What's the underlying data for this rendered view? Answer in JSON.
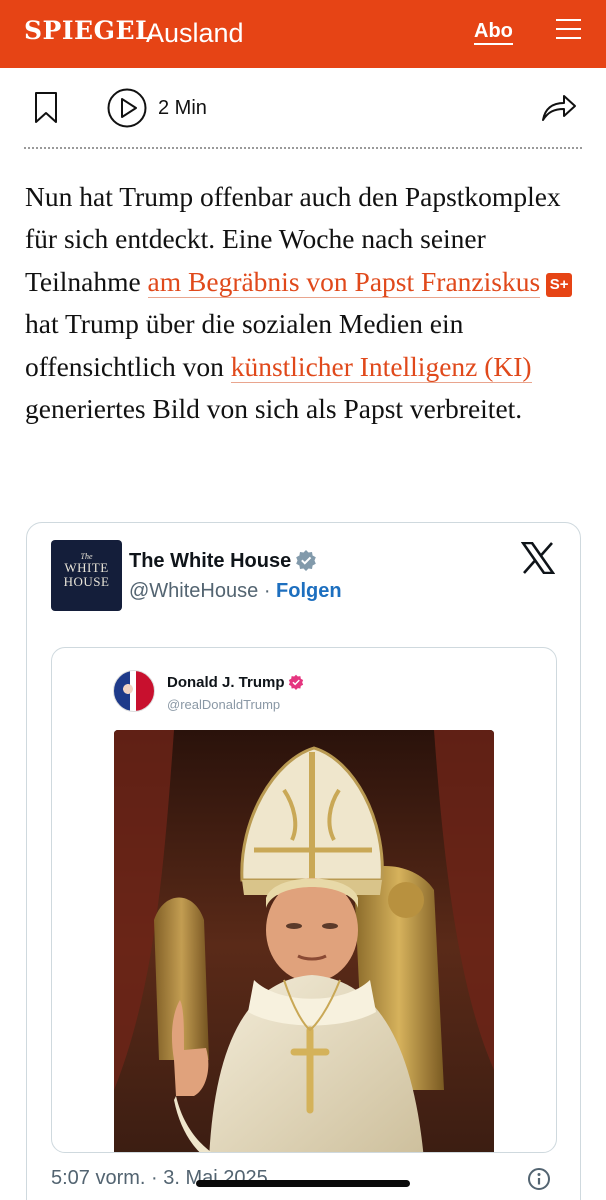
{
  "header": {
    "logo": "SPIEGEL",
    "section": "Ausland",
    "abo_label": "Abo",
    "menu_icon": "hamburger-icon",
    "background_color": "#e64415"
  },
  "actions": {
    "bookmark_icon": "bookmark-icon",
    "audio_icon": "play-icon",
    "read_time": "2 Min",
    "share_icon": "share-icon"
  },
  "article": {
    "text_1": "Nun hat Trump offenbar auch den Papstkomplex für sich entdeckt. Eine Woche nach seiner Teilnahme ",
    "link_1": "am Begräbnis von Papst Franziskus",
    "badge": "S+",
    "text_2": " hat Trump über die sozialen Medien ein offensichtlich von ",
    "link_2": "künstlicher Intelligenz (KI)",
    "text_3": " generiertes Bild von sich als Papst verbreitet.",
    "link_color": "#e0491b"
  },
  "tweet": {
    "avatar_text_small": "The",
    "avatar_text_line1": "WHITE",
    "avatar_text_line2": "HOUSE",
    "name": "The White House",
    "handle": "@WhiteHouse",
    "separator": "·",
    "follow_label": "Folgen",
    "platform_icon": "x-logo-icon",
    "timestamp": "5:07 vorm. · 3. Mai 2025",
    "info_icon": "info-icon",
    "quoted": {
      "name": "Donald J. Trump",
      "handle": "@realDonaldTrump",
      "image_description_icon": "pope-portrait-image"
    }
  }
}
